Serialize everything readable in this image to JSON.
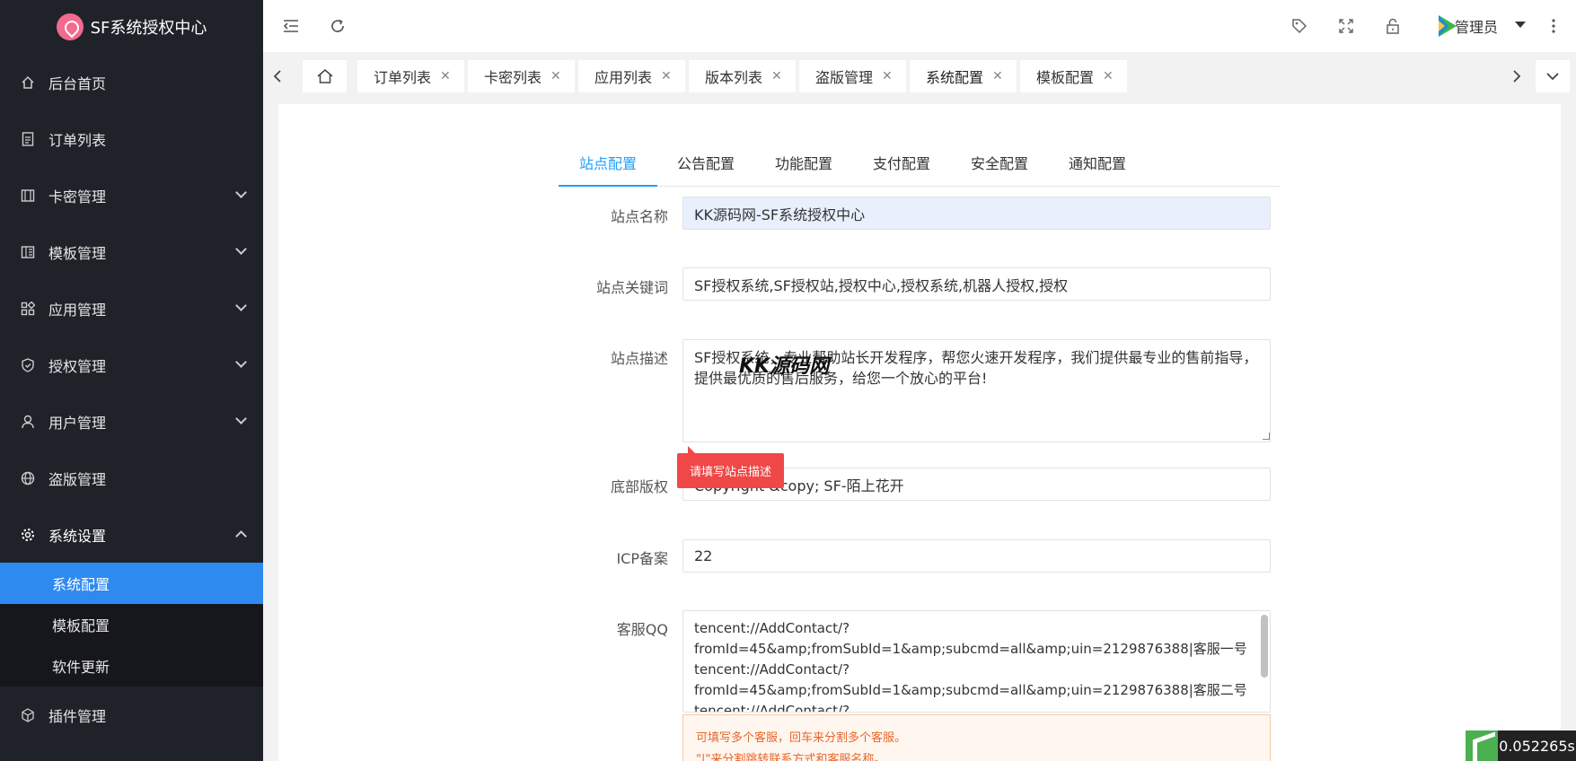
{
  "app": {
    "title": "SF系统授权中心"
  },
  "sidebar": {
    "items": [
      {
        "label": "后台首页",
        "icon": "home-icon"
      },
      {
        "label": "订单列表",
        "icon": "file-icon"
      },
      {
        "label": "卡密管理",
        "icon": "card-icon"
      },
      {
        "label": "模板管理",
        "icon": "template-icon"
      },
      {
        "label": "应用管理",
        "icon": "apps-icon"
      },
      {
        "label": "授权管理",
        "icon": "shield-icon"
      },
      {
        "label": "用户管理",
        "icon": "user-icon"
      },
      {
        "label": "盗版管理",
        "icon": "globe-icon"
      },
      {
        "label": "系统设置",
        "icon": "gear-icon"
      }
    ],
    "sub_items": [
      {
        "label": "系统配置",
        "active": true
      },
      {
        "label": "模板配置",
        "active": false
      },
      {
        "label": "软件更新",
        "active": false
      }
    ],
    "bottom_item": {
      "label": "插件管理",
      "icon": "cube-icon"
    }
  },
  "header": {
    "admin_name": "管理员"
  },
  "tabs": [
    {
      "label": "订单列表"
    },
    {
      "label": "卡密列表"
    },
    {
      "label": "应用列表"
    },
    {
      "label": "版本列表"
    },
    {
      "label": "盗版管理"
    },
    {
      "label": "系统配置",
      "active": true
    },
    {
      "label": "模板配置"
    }
  ],
  "subtabs": [
    {
      "label": "站点配置",
      "active": true
    },
    {
      "label": "公告配置"
    },
    {
      "label": "功能配置"
    },
    {
      "label": "支付配置"
    },
    {
      "label": "安全配置"
    },
    {
      "label": "通知配置"
    }
  ],
  "form": {
    "site_name": {
      "label": "站点名称",
      "value": "KK源码网-SF系统授权中心"
    },
    "site_keywords": {
      "label": "站点关键词",
      "value": "SF授权系统,SF授权站,授权中心,授权系统,机器人授权,授权"
    },
    "site_desc": {
      "label": "站点描述",
      "value": "SF授权系统，专业帮助站长开发程序，帮您火速开发程序，我们提供最专业的售前指导，提供最优质的售后服务，给您一个放心的平台!"
    },
    "footer_copyright": {
      "label": "底部版权",
      "value": "Copyright &copy; SF-陌上花开"
    },
    "icp": {
      "label": "ICP备案",
      "value": "22"
    },
    "service_qq": {
      "label": "客服QQ",
      "value": "tencent://AddContact/?fromId=45&amp;fromSubId=1&amp;subcmd=all&amp;uin=2129876388|客服一号\ntencent://AddContact/?fromId=45&amp;fromSubId=1&amp;subcmd=all&amp;uin=2129876388|客服二号\ntencent://AddContact/?"
    }
  },
  "validation_tip": "请填写站点描述",
  "watermark": "KK源码网",
  "hint": {
    "line1": "可填写多个客服，回车来分割多个客服。",
    "line2": "\"|\"来分割跳转联系方式和客服名称。"
  },
  "timer": "0.052265s"
}
